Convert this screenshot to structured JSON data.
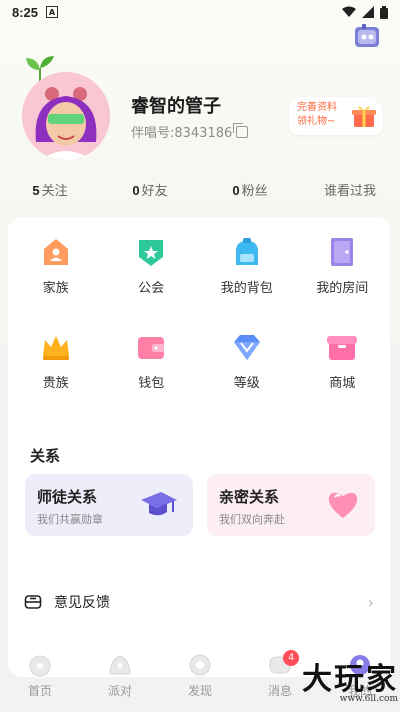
{
  "status_bar": {
    "time": "8:25",
    "notification": "A"
  },
  "profile": {
    "name": "睿智的管子",
    "id_label": "伴唱号:8343186",
    "gift_line1": "完善资料",
    "gift_line2": "领礼物~"
  },
  "stats": [
    {
      "count": "5",
      "label": "关注"
    },
    {
      "count": "0",
      "label": "好友"
    },
    {
      "count": "0",
      "label": "粉丝"
    },
    {
      "count": "",
      "label": "谁看过我"
    }
  ],
  "grid": [
    {
      "label": "家族",
      "icon": "family-icon"
    },
    {
      "label": "公会",
      "icon": "guild-icon"
    },
    {
      "label": "我的背包",
      "icon": "backpack-icon"
    },
    {
      "label": "我的房间",
      "icon": "room-icon"
    },
    {
      "label": "贵族",
      "icon": "crown-icon"
    },
    {
      "label": "钱包",
      "icon": "wallet-icon"
    },
    {
      "label": "等级",
      "icon": "diamond-icon"
    },
    {
      "label": "商城",
      "icon": "shop-icon"
    }
  ],
  "relations": {
    "title": "关系",
    "mentor": {
      "title": "师徒关系",
      "subtitle": "我们共赢勋章"
    },
    "intimate": {
      "title": "亲密关系",
      "subtitle": "我们双向奔赴"
    }
  },
  "feedback": {
    "label": "意见反馈"
  },
  "tabs": [
    {
      "label": "首页"
    },
    {
      "label": "派对"
    },
    {
      "label": "发现"
    },
    {
      "label": "消息",
      "badge": "4"
    },
    {
      "label": "我的"
    }
  ],
  "watermark": {
    "text": "大玩家",
    "url": "www.6ll.com"
  }
}
